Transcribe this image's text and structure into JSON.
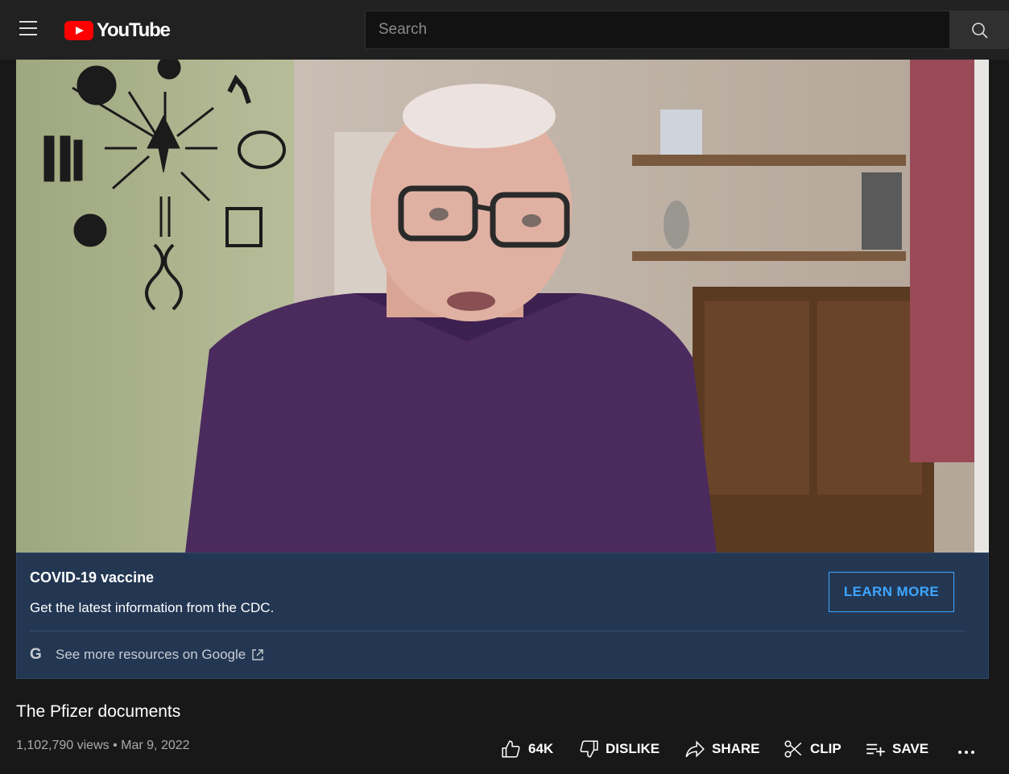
{
  "header": {
    "logo_text": "YouTube",
    "search_placeholder": "Search"
  },
  "notice": {
    "title": "COVID-19 vaccine",
    "subtitle": "Get the latest information from the CDC.",
    "button_label": "LEARN MORE",
    "google_icon_letter": "G",
    "link_text": "See more resources on Google"
  },
  "video": {
    "title": "The Pfizer documents",
    "views": "1,102,790 views",
    "separator": "•",
    "date": "Mar 9, 2022"
  },
  "actions": {
    "like_count": "64K",
    "dislike_label": "DISLIKE",
    "share_label": "SHARE",
    "clip_label": "CLIP",
    "save_label": "SAVE"
  },
  "colors": {
    "youtube_red": "#ff0000",
    "notice_bg": "#233753",
    "link_blue": "#3ea6ff"
  }
}
